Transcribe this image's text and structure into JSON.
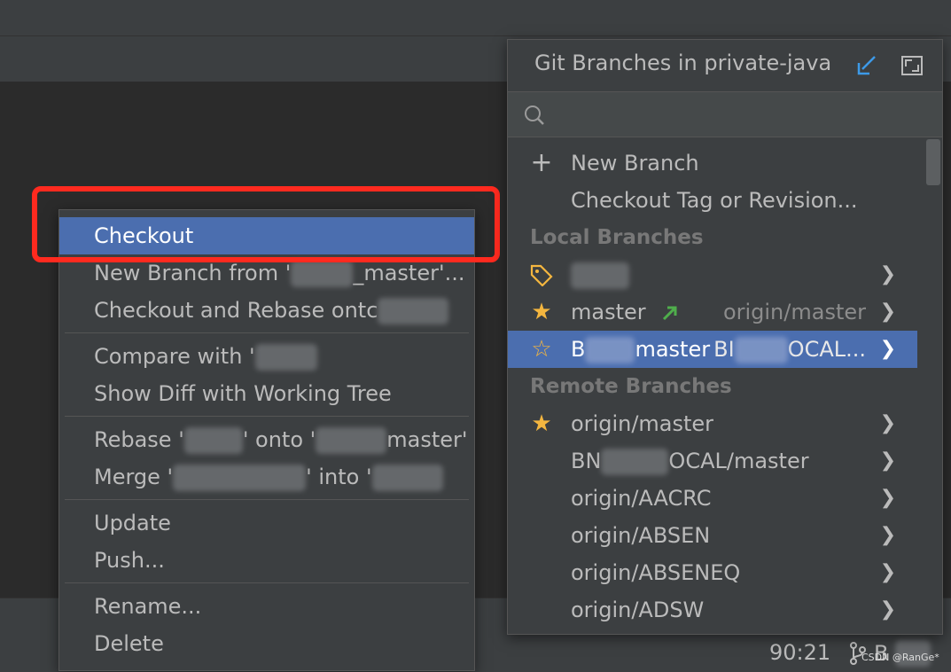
{
  "context_menu": {
    "items": [
      {
        "label": "Checkout",
        "selected": true
      },
      {
        "label": "New Branch from '",
        "suffix": "_master'..."
      },
      {
        "label": "Checkout and Rebase ontc"
      },
      {
        "label": "Compare with '"
      },
      {
        "label": "Show Diff with Working Tree"
      },
      {
        "label": "Rebase '",
        "mid": "' onto '",
        "suffix": "master'"
      },
      {
        "label": "Merge '",
        "mid": "' into '"
      },
      {
        "label": "Update"
      },
      {
        "label": "Push..."
      },
      {
        "label": "Rename..."
      },
      {
        "label": "Delete"
      }
    ]
  },
  "branches_popup": {
    "title": "Git Branches in private-java",
    "search_placeholder": "",
    "actions": [
      {
        "label": "New Branch",
        "icon": "plus-icon"
      },
      {
        "label": "Checkout Tag or Revision..."
      }
    ],
    "local_header": "Local Branches",
    "local": [
      {
        "name": "",
        "icon": "tag-icon",
        "track": ""
      },
      {
        "name": "master",
        "icon": "star-filled-icon",
        "track": "origin/master",
        "outgoing": true
      },
      {
        "name": "B",
        "name_suffix": "master",
        "icon": "star-outline-icon",
        "track": "BI",
        "track_suffix": "OCAL...",
        "selected": true
      }
    ],
    "remote_header": "Remote Branches",
    "remote": [
      {
        "name": "origin/master",
        "icon": "star-filled-icon"
      },
      {
        "name": "BN",
        "name_suffix": "OCAL/master"
      },
      {
        "name": "origin/AACRC"
      },
      {
        "name": "origin/ABSEN"
      },
      {
        "name": "origin/ABSENEQ"
      },
      {
        "name": "origin/ADSW"
      }
    ]
  },
  "status": {
    "position": "90:21",
    "branch": "B",
    "watermark": "CSDN @RanGe*"
  },
  "colors": {
    "accent": "#4b6eaf",
    "highlight": "#ff2a1f",
    "star": "#f4b63f",
    "outgoing_arrow": "#4fae4c"
  }
}
